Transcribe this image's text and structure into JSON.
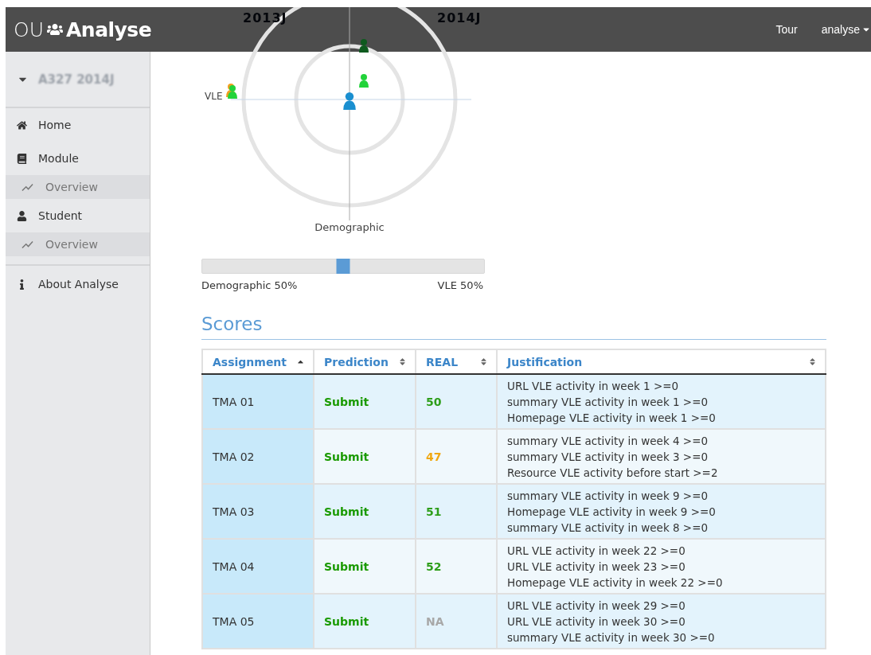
{
  "header": {
    "logo_left": "OU",
    "logo_right": "Analyse",
    "links": [
      {
        "label": "Tour",
        "dropdown": false
      },
      {
        "label": "analyse",
        "dropdown": true
      }
    ]
  },
  "sidebar": {
    "course": {
      "label": "A327 2014J",
      "expanded": true
    },
    "items": [
      {
        "label": "Home",
        "kind": "main"
      },
      {
        "label": "Module",
        "kind": "main"
      },
      {
        "label": "Overview",
        "kind": "sub"
      },
      {
        "label": "Student",
        "kind": "main"
      },
      {
        "label": "Overview",
        "kind": "sub"
      },
      {
        "label": "About Analyse",
        "kind": "footer"
      }
    ]
  },
  "plot": {
    "top_labels": [
      "2013J",
      "2014J"
    ],
    "x_label": "VLE",
    "y_label": "Demographic"
  },
  "weight_slider": {
    "level": 0.5,
    "left_label": "Demographic 50%",
    "right_label": "VLE 50%"
  },
  "scores": {
    "title": "Scores",
    "columns": [
      {
        "label": "Assignment",
        "sorted": true
      },
      {
        "label": "Prediction",
        "sorted": false
      },
      {
        "label": "REAL",
        "sorted": false
      },
      {
        "label": "Justification",
        "sorted": false
      }
    ],
    "rows": [
      {
        "assignment": "TMA 01",
        "prediction": "Submit",
        "real": "50",
        "kind": "pass",
        "justification": [
          "URL VLE activity in week 1 >=0",
          "summary VLE activity in week 1 >=0",
          "Homepage VLE activity in week 1 >=0"
        ]
      },
      {
        "assignment": "TMA 02",
        "prediction": "Submit",
        "real": "47",
        "kind": "warn",
        "justification": [
          "summary VLE activity in week 4 >=0",
          "summary VLE activity in week 3 >=0",
          "Resource VLE activity before start >=2"
        ]
      },
      {
        "assignment": "TMA 03",
        "prediction": "Submit",
        "real": "51",
        "kind": "pass",
        "justification": [
          "summary VLE activity in week 9 >=0",
          "Homepage VLE activity in week 9 >=0",
          "summary VLE activity in week 8 >=0"
        ]
      },
      {
        "assignment": "TMA 04",
        "prediction": "Submit",
        "real": "52",
        "kind": "pass",
        "justification": [
          "URL VLE activity in week 22 >=0",
          "URL VLE activity in week 23 >=0",
          "Homepage VLE activity in week 22 >=0"
        ]
      },
      {
        "assignment": "TMA 05",
        "prediction": "Submit",
        "real": "NA",
        "kind": "missing",
        "justification": [
          "URL VLE activity in week 29 >=0",
          "URL VLE activity in week 30 >=0",
          "summary VLE activity in week 30 >=0"
        ]
      }
    ]
  }
}
